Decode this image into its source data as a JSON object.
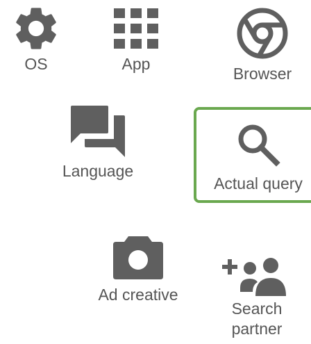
{
  "tiles": {
    "os": {
      "label": "OS",
      "icon": "gear-icon"
    },
    "app": {
      "label": "App",
      "icon": "grid-icon"
    },
    "browser": {
      "label": "Browser",
      "icon": "chrome-icon"
    },
    "language": {
      "label": "Language",
      "icon": "chat-bubbles-icon"
    },
    "query": {
      "label": "Actual query",
      "icon": "search-icon",
      "selected": true
    },
    "creative": {
      "label": "Ad creative",
      "icon": "camera-icon"
    },
    "partner": {
      "label": "Search partner",
      "icon": "add-people-icon"
    }
  },
  "colors": {
    "icon": "#5f5f5f",
    "text": "#555555",
    "selected_border": "#6aa84f",
    "background": "#ffffff"
  }
}
